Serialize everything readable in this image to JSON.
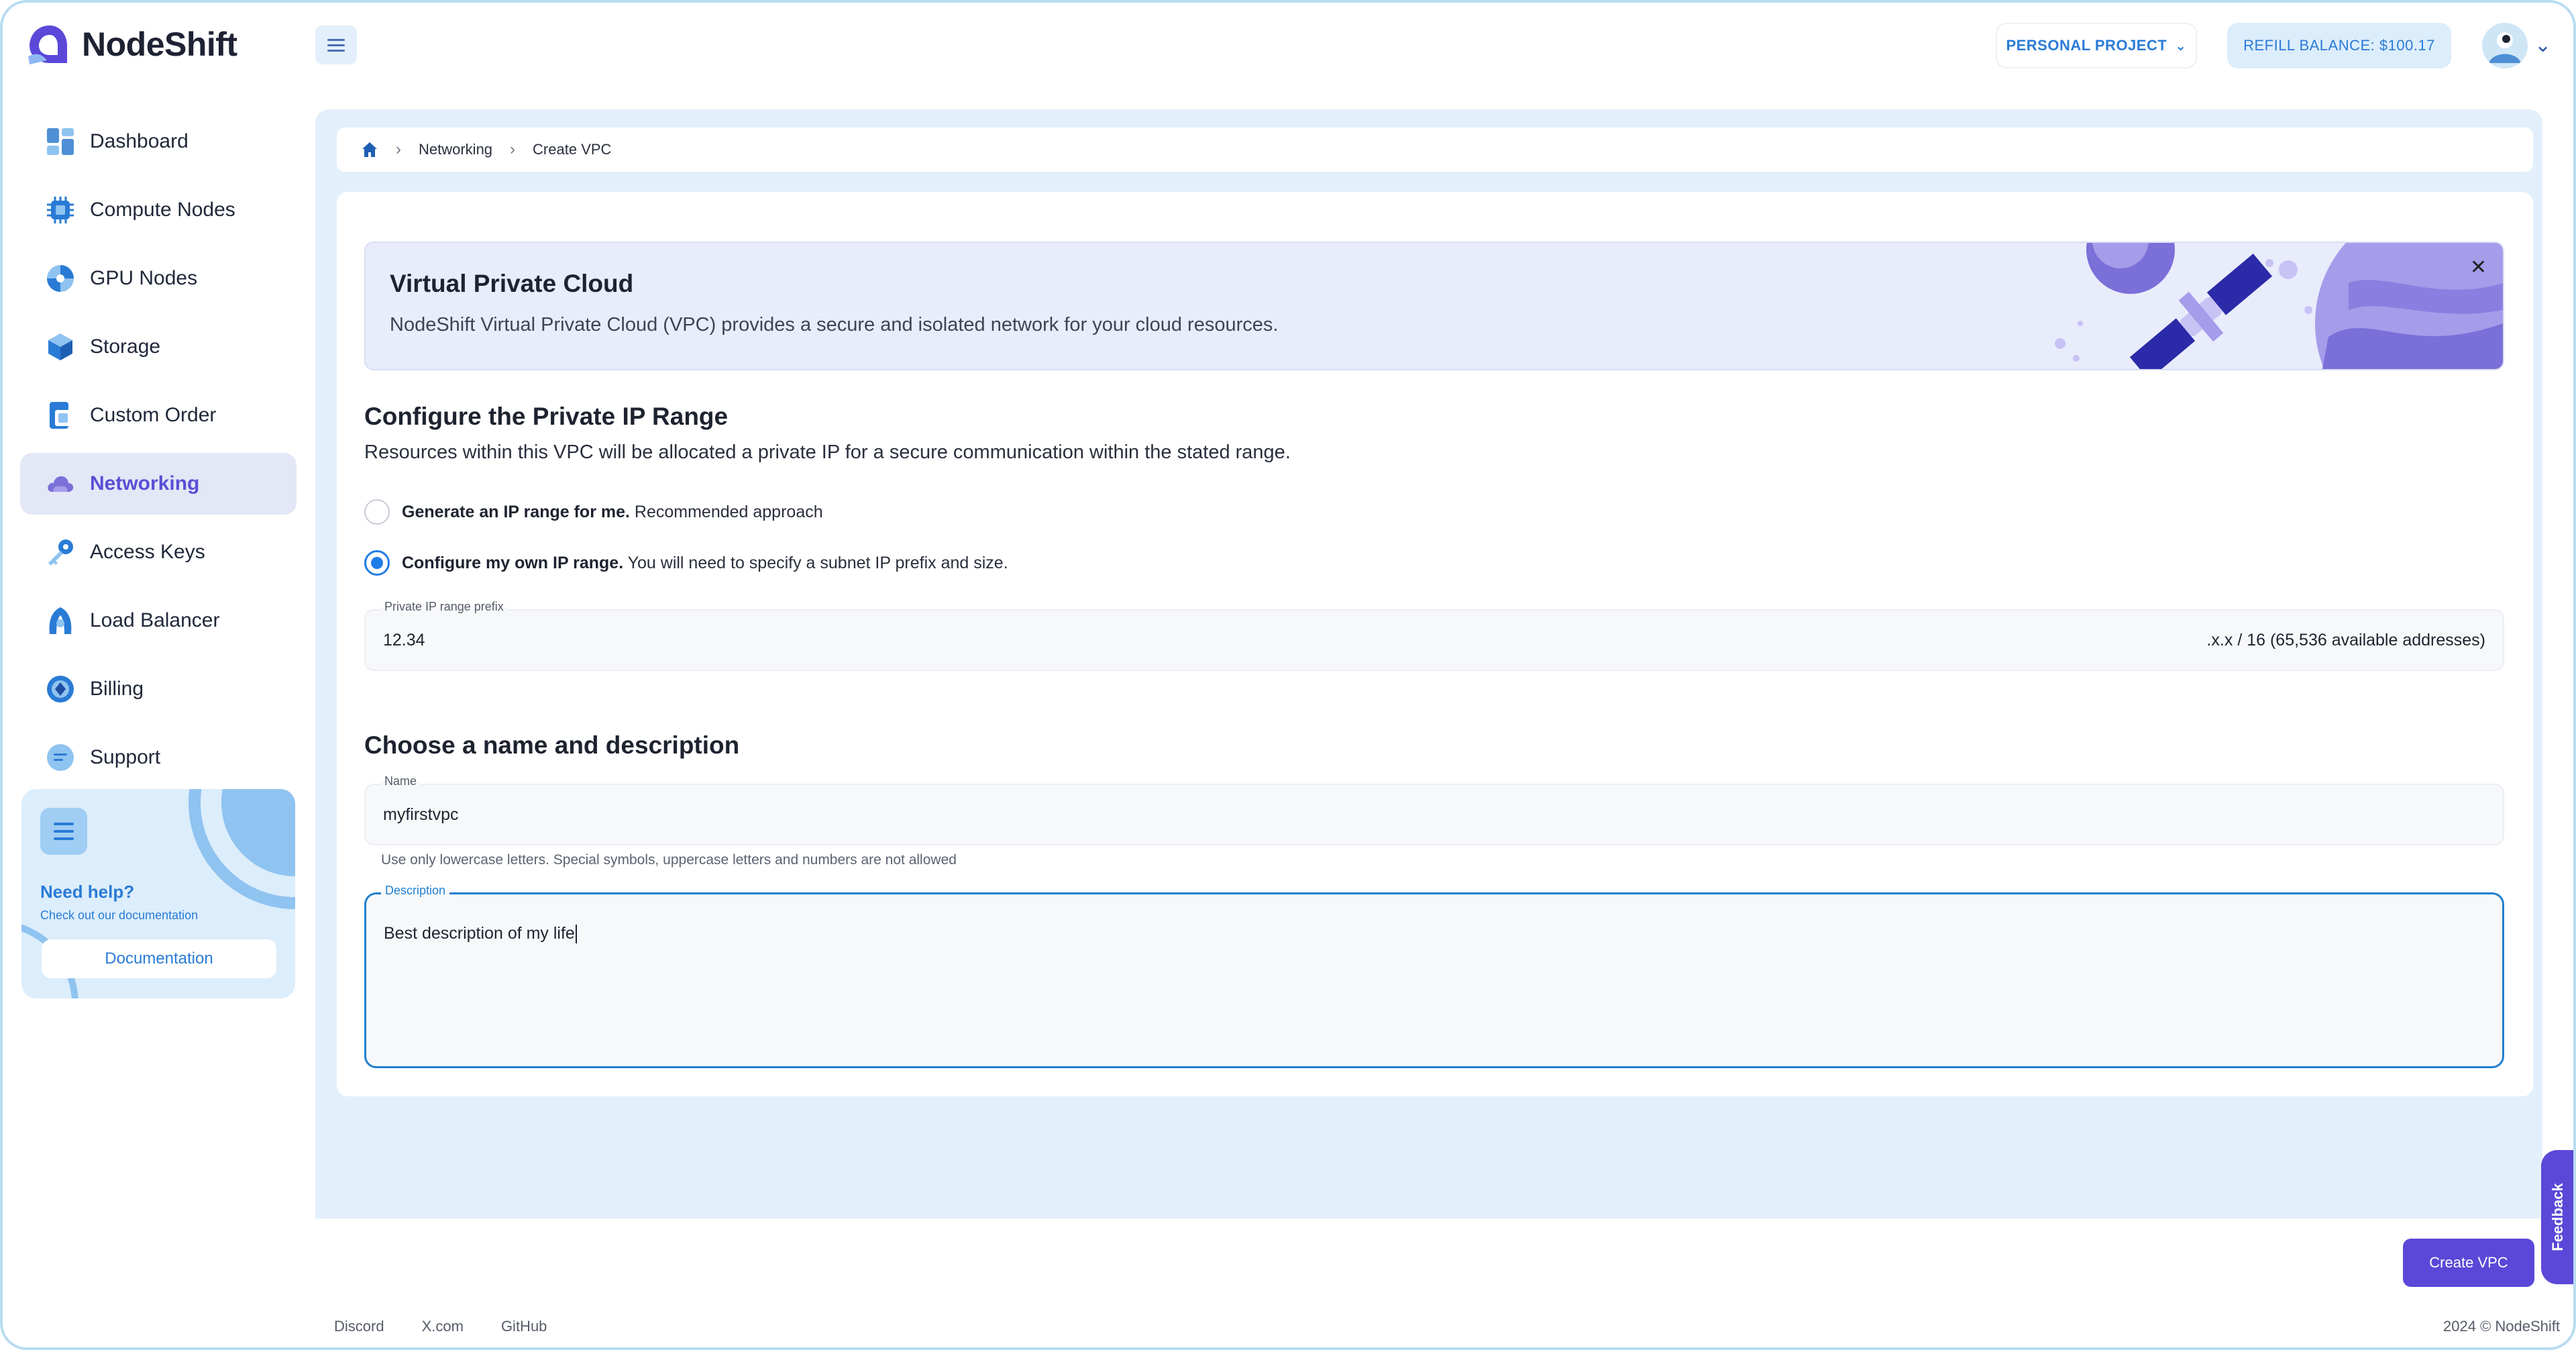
{
  "brand": {
    "name": "NodeShift",
    "accent": "#5b48d8",
    "link": "#2a7bd6"
  },
  "header": {
    "project_label": "PERSONAL PROJECT",
    "refill_label": "REFILL BALANCE: $100.17"
  },
  "sidebar": {
    "items": [
      {
        "label": "Dashboard",
        "icon": "dashboard-icon"
      },
      {
        "label": "Compute Nodes",
        "icon": "chip-icon"
      },
      {
        "label": "GPU Nodes",
        "icon": "gpu-icon"
      },
      {
        "label": "Storage",
        "icon": "cube-icon"
      },
      {
        "label": "Custom Order",
        "icon": "order-icon"
      },
      {
        "label": "Networking",
        "icon": "cloud-icon",
        "active": true
      },
      {
        "label": "Access Keys",
        "icon": "key-icon"
      },
      {
        "label": "Load Balancer",
        "icon": "balancer-icon"
      },
      {
        "label": "Billing",
        "icon": "billing-icon"
      },
      {
        "label": "Support",
        "icon": "chat-icon"
      }
    ],
    "help": {
      "title": "Need help?",
      "subtitle": "Check out our documentation",
      "button": "Documentation"
    }
  },
  "breadcrumb": {
    "items": [
      "Networking",
      "Create VPC"
    ]
  },
  "banner": {
    "title": "Virtual Private Cloud",
    "text": "NodeShift Virtual Private Cloud (VPC) provides a secure and isolated network for your cloud resources."
  },
  "ip_section": {
    "title": "Configure the Private IP Range",
    "description": "Resources within this VPC will be allocated a private IP for a secure communication within the stated range.",
    "option_generate": {
      "bold": "Generate an IP range for me.",
      "rest": " Recommended approach",
      "checked": false
    },
    "option_custom": {
      "bold": "Configure my own IP range.",
      "rest": " You will need to specify a subnet IP prefix and size.",
      "checked": true
    },
    "prefix_label": "Private IP range prefix",
    "prefix_value": "12.34",
    "prefix_suffix": ".x.x / 16 (65,536 available addresses)"
  },
  "name_section": {
    "title": "Choose a name and description",
    "name_label": "Name",
    "name_value": "myfirstvpc",
    "name_hint": "Use only lowercase letters. Special symbols, uppercase letters and numbers are not allowed",
    "description_label": "Description",
    "description_value": "Best description of my life"
  },
  "actions": {
    "create": "Create VPC",
    "feedback": "Feedback"
  },
  "footer": {
    "links": [
      "Discord",
      "X.com",
      "GitHub"
    ],
    "copyright": "2024 © NodeShift"
  }
}
